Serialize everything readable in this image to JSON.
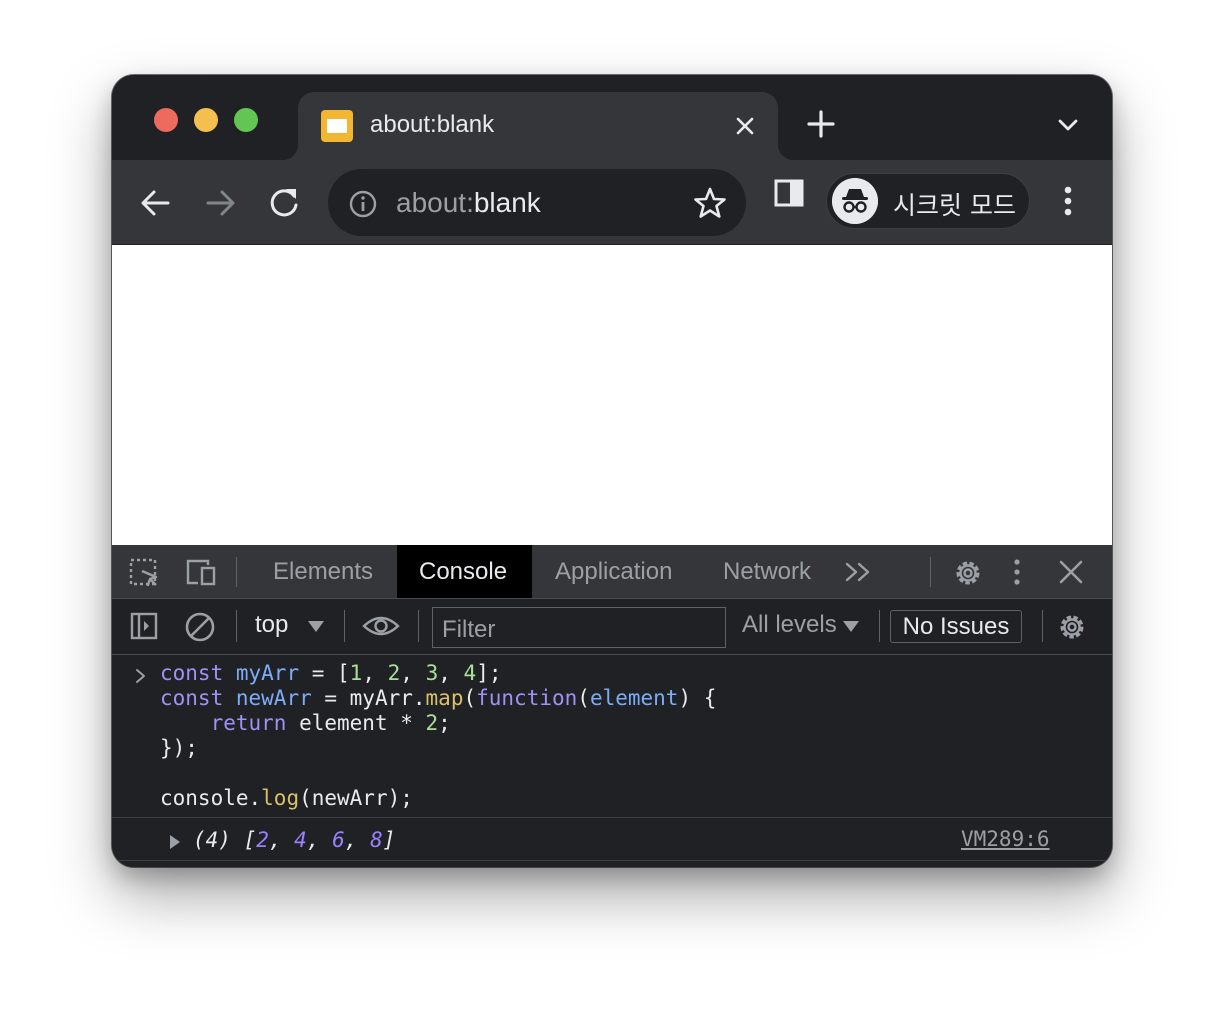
{
  "browser": {
    "tab": {
      "title": "about:blank"
    },
    "toolbar": {
      "url_scheme": "about:",
      "url_host": "blank",
      "incognito_label": "시크릿 모드"
    }
  },
  "devtools": {
    "tabs": [
      "Elements",
      "Console",
      "Application",
      "Network"
    ],
    "active_tab": "Console",
    "console_toolbar": {
      "context": "top",
      "filter_placeholder": "Filter",
      "levels": "All levels",
      "issues": "No Issues"
    },
    "console": {
      "input_lines": [
        "const myArr = [1, 2, 3, 4];",
        "const newArr = myArr.map(function(element) {",
        "    return element * 2;",
        "});",
        "",
        "console.log(newArr);"
      ],
      "output": {
        "count": "(4)",
        "values": [
          "2",
          "4",
          "6",
          "8"
        ],
        "source": "VM289:6"
      }
    }
  },
  "colors": {
    "chrome_dark": "#202124",
    "toolbar": "#35363a",
    "keyword": "#9e92f7",
    "variable": "#7cacf8",
    "function": "#d9c06c",
    "literal": "#a8e09a",
    "number": "#9980ff"
  }
}
